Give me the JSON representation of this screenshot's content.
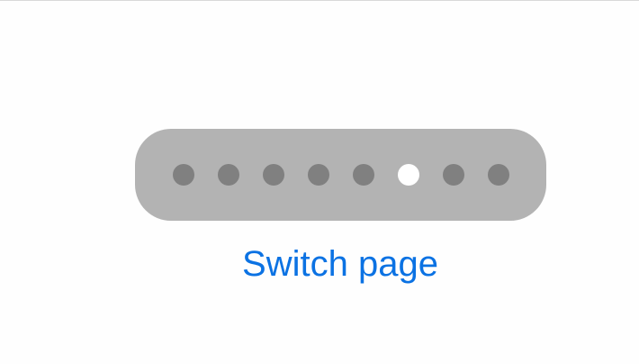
{
  "page_control": {
    "total_pages": 8,
    "current_page": 6,
    "pages": [
      {
        "index": 1,
        "active": false
      },
      {
        "index": 2,
        "active": false
      },
      {
        "index": 3,
        "active": false
      },
      {
        "index": 4,
        "active": false
      },
      {
        "index": 5,
        "active": false
      },
      {
        "index": 6,
        "active": true
      },
      {
        "index": 7,
        "active": false
      },
      {
        "index": 8,
        "active": false
      }
    ],
    "colors": {
      "track": "#b3b3b3",
      "dot_inactive": "#808080",
      "dot_active": "#ffffff"
    }
  },
  "action": {
    "label": "Switch page",
    "color": "#0b72e3"
  }
}
